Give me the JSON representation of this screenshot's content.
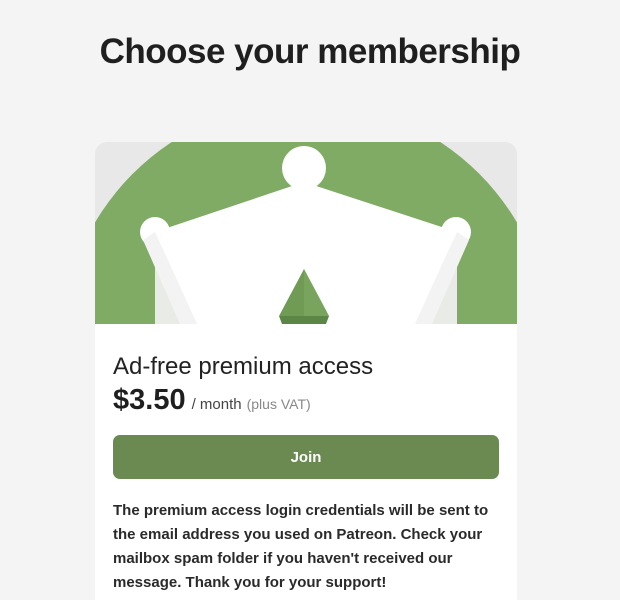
{
  "page": {
    "title": "Choose your membership"
  },
  "tier": {
    "name": "Ad-free premium access",
    "price": "$3.50",
    "period": "/ month",
    "tax_note": "(plus VAT)",
    "join_label": "Join",
    "description": "The premium access login credentials will be sent to the email address you used on Patreon. Check your mailbox spam folder if you haven't received our message. Thank you for your support!",
    "banner_icon": "crown-icon"
  },
  "colors": {
    "background": "#f4f4f4",
    "card": "#ffffff",
    "banner_background": "#e8e8e8",
    "banner_circle": "#7fab64",
    "crown": "#ffffff",
    "gem": "#6f9b55",
    "join_button": "#6a8a51",
    "join_text": "#ffffff"
  }
}
